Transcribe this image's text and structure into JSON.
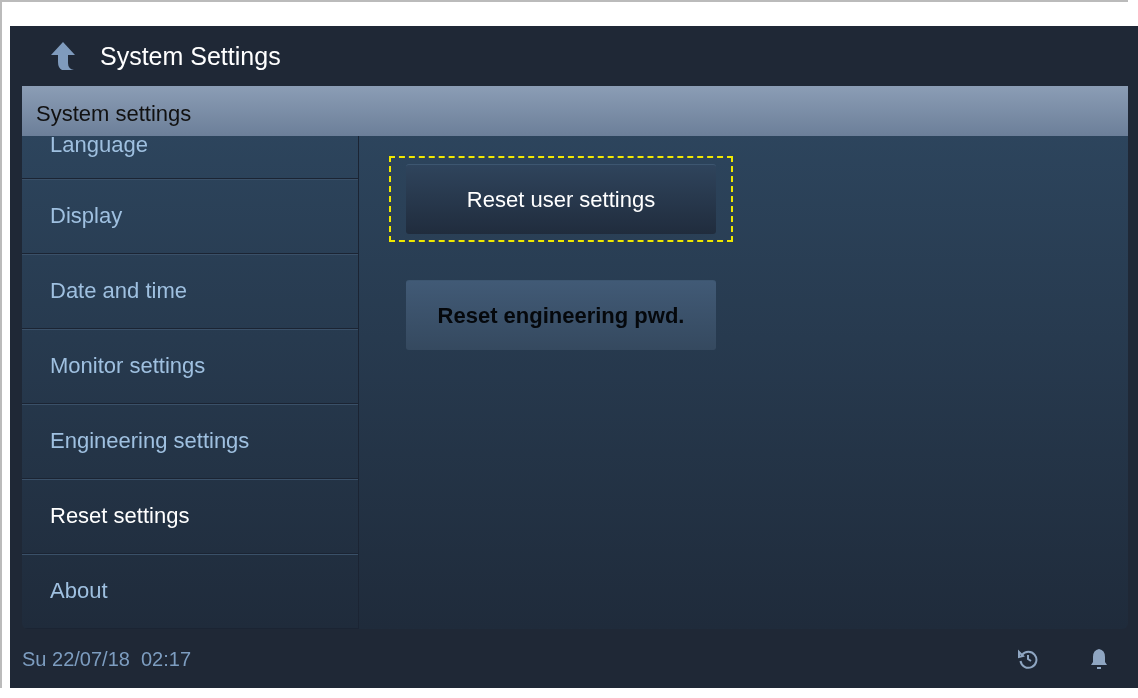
{
  "header": {
    "title": "System Settings"
  },
  "section_title": "System settings",
  "sidebar": {
    "items": [
      {
        "label": "Language",
        "selected": false
      },
      {
        "label": "Display",
        "selected": false
      },
      {
        "label": "Date and time",
        "selected": false
      },
      {
        "label": "Monitor settings",
        "selected": false
      },
      {
        "label": "Engineering settings",
        "selected": false
      },
      {
        "label": "Reset settings",
        "selected": true
      },
      {
        "label": "About",
        "selected": false
      }
    ]
  },
  "buttons": [
    {
      "label": "Reset user settings",
      "focused": true,
      "disabled": false
    },
    {
      "label": "Reset engineering pwd.",
      "focused": false,
      "disabled": true
    }
  ],
  "status_bar": {
    "datetime": "Su 22/07/18  02:17"
  }
}
